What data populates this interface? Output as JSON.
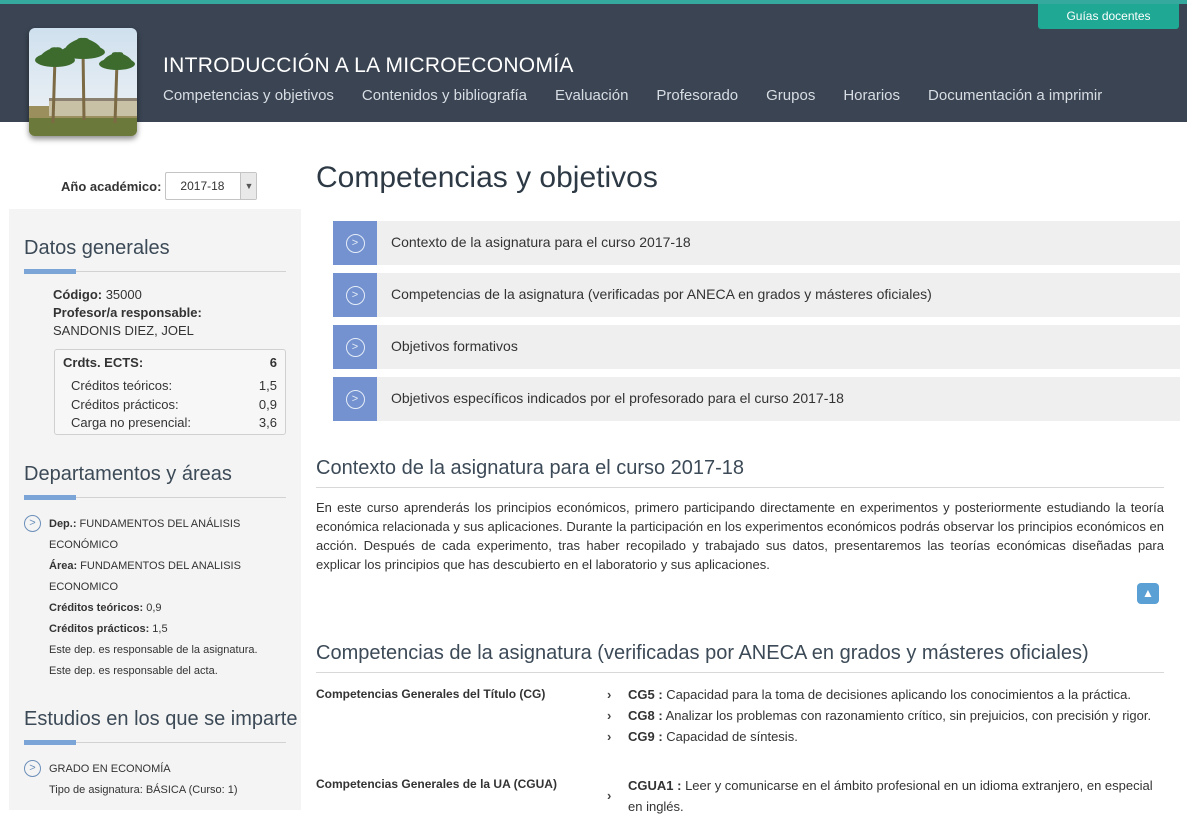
{
  "header": {
    "top_button": "Guías docentes",
    "subject_title": "INTRODUCCIÓN A LA MICROECONOMÍA",
    "nav": [
      "Competencias y objetivos",
      "Contenidos y bibliografía",
      "Evaluación",
      "Profesorado",
      "Grupos",
      "Horarios",
      "Documentación a imprimir"
    ]
  },
  "sidebar": {
    "year_label": "Año académico:",
    "year_value": "2017-18",
    "datos_title": "Datos generales",
    "codigo_label": "Código:",
    "codigo_value": " 35000",
    "profesor_label": "Profesor/a responsable:",
    "profesor_value": "SANDONIS DIEZ, JOEL",
    "ects": {
      "label": "Crdts. ECTS:",
      "value": "6",
      "rows": [
        {
          "label": "Créditos teóricos:",
          "value": "1,5"
        },
        {
          "label": "Créditos prácticos:",
          "value": "0,9"
        },
        {
          "label": "Carga no presencial:",
          "value": "3,6"
        }
      ]
    },
    "dep_title": "Departamentos y áreas",
    "dep": {
      "dep_label": "Dep.:",
      "dep_value": " FUNDAMENTOS DEL ANÁLISIS",
      "dep_value2": "ECONÓMICO",
      "area_label": "Área:",
      "area_value": " FUNDAMENTOS DEL ANALISIS",
      "area_value2": "ECONOMICO",
      "ct_label": "Créditos teóricos:",
      "ct_value": " 0,9",
      "cp_label": "Créditos prácticos:",
      "cp_value": " 1,5",
      "note1": "Este dep. es responsable de la asignatura.",
      "note2": "Este dep. es responsable del acta."
    },
    "estudios_title": "Estudios en los que se imparte",
    "estudio": {
      "name": "GRADO EN ECONOMÍA",
      "tipo": "Tipo de asignatura: BÁSICA (Curso: 1)"
    }
  },
  "main": {
    "title": "Competencias y objetivos",
    "accordion": [
      "Contexto de la asignatura para el curso 2017-18",
      "Competencias de la asignatura (verificadas por ANECA en grados y másteres oficiales)",
      "Objetivos formativos",
      "Objetivos específicos indicados por el profesorado para el curso 2017-18"
    ],
    "contexto_title": "Contexto de la asignatura para el curso 2017-18",
    "contexto_text": "En este curso aprenderás los principios económicos, primero participando directamente en experimentos y posteriormente estudiando la teoría económica relacionada y sus aplicaciones. Durante la participación en los experimentos económicos podrás observar los principios económicos en acción. Después de cada experimento, tras haber recopilado y trabajado sus datos, presentaremos las teorías económicas diseñadas para explicar los principios que has descubierto en el laboratorio y sus aplicaciones.",
    "competencias_title": "Competencias de la asignatura (verificadas por ANECA en grados y másteres oficiales)",
    "cg_label": "Competencias Generales del Título (CG)",
    "cg_items": [
      {
        "code": "CG5 :",
        "text": " Capacidad para la toma de decisiones aplicando los conocimientos a la práctica."
      },
      {
        "code": "CG8 :",
        "text": " Analizar los problemas con razonamiento crítico, sin prejuicios, con precisión y rigor."
      },
      {
        "code": "CG9 :",
        "text": " Capacidad de síntesis."
      }
    ],
    "cgua_label": "Competencias Generales de la UA (CGUA)",
    "cgua_items": [
      {
        "code": "CGUA1 :",
        "text": " Leer y comunicarse en el ámbito profesional en un idioma extranjero, en especial en inglés."
      }
    ]
  },
  "colors": {
    "header_bg": "#3a4452",
    "accent_teal": "#1fa894",
    "accordion_icon": "#7392cf",
    "rule_accent": "#7aa5d6"
  }
}
